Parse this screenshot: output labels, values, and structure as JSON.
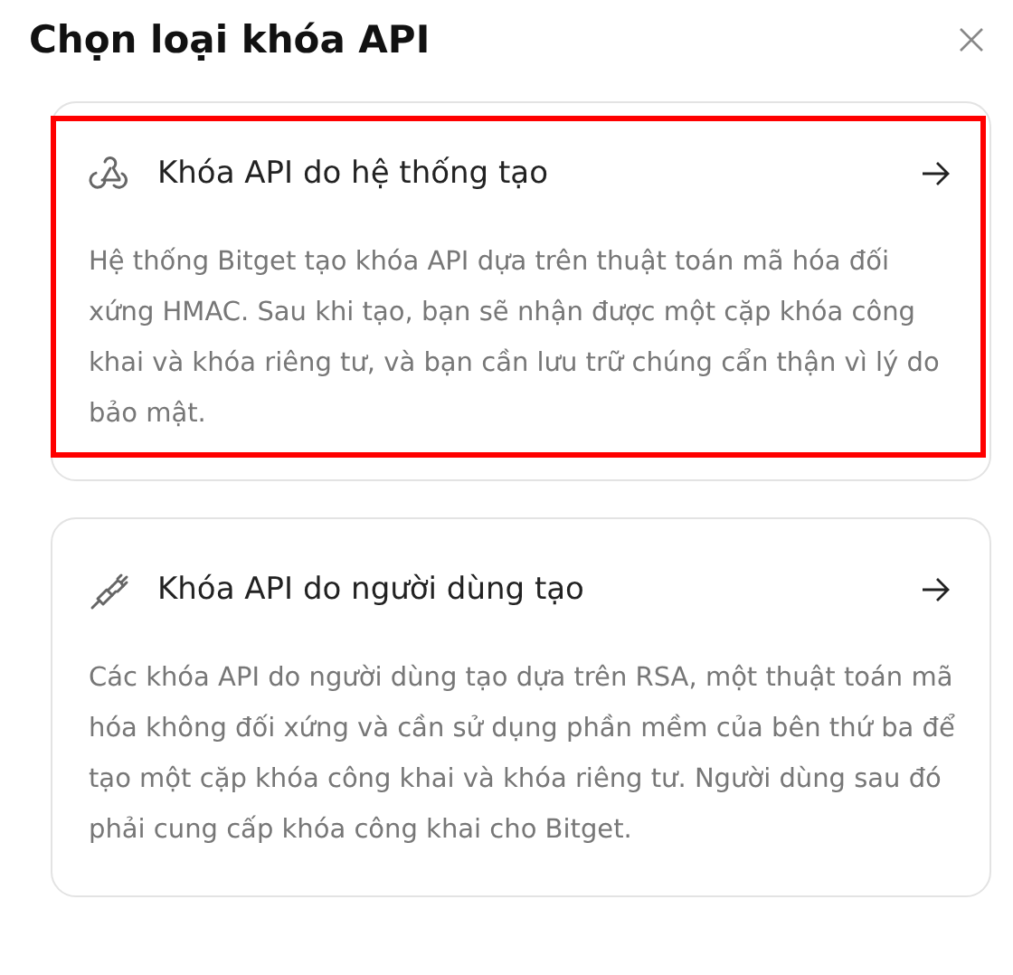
{
  "title": "Chọn loại khóa API",
  "options": [
    {
      "kind": "system",
      "title": "Khóa API do hệ thống tạo",
      "description": "Hệ thống Bitget tạo khóa API dựa trên thuật toán mã hóa đối xứng HMAC. Sau khi tạo, bạn sẽ nhận được một cặp khóa công khai và khóa riêng tư, và bạn cần lưu trữ chúng cẩn thận vì lý do bảo mật.",
      "highlighted": true
    },
    {
      "kind": "user",
      "title": "Khóa API do người dùng tạo",
      "description": "Các khóa API do người dùng tạo dựa trên RSA, một thuật toán mã hóa không đối xứng và cần sử dụng phần mềm của bên thứ ba để tạo một cặp khóa công khai và khóa riêng tư. Người dùng sau đó phải cung cấp khóa công khai cho Bitget.",
      "highlighted": false
    }
  ]
}
